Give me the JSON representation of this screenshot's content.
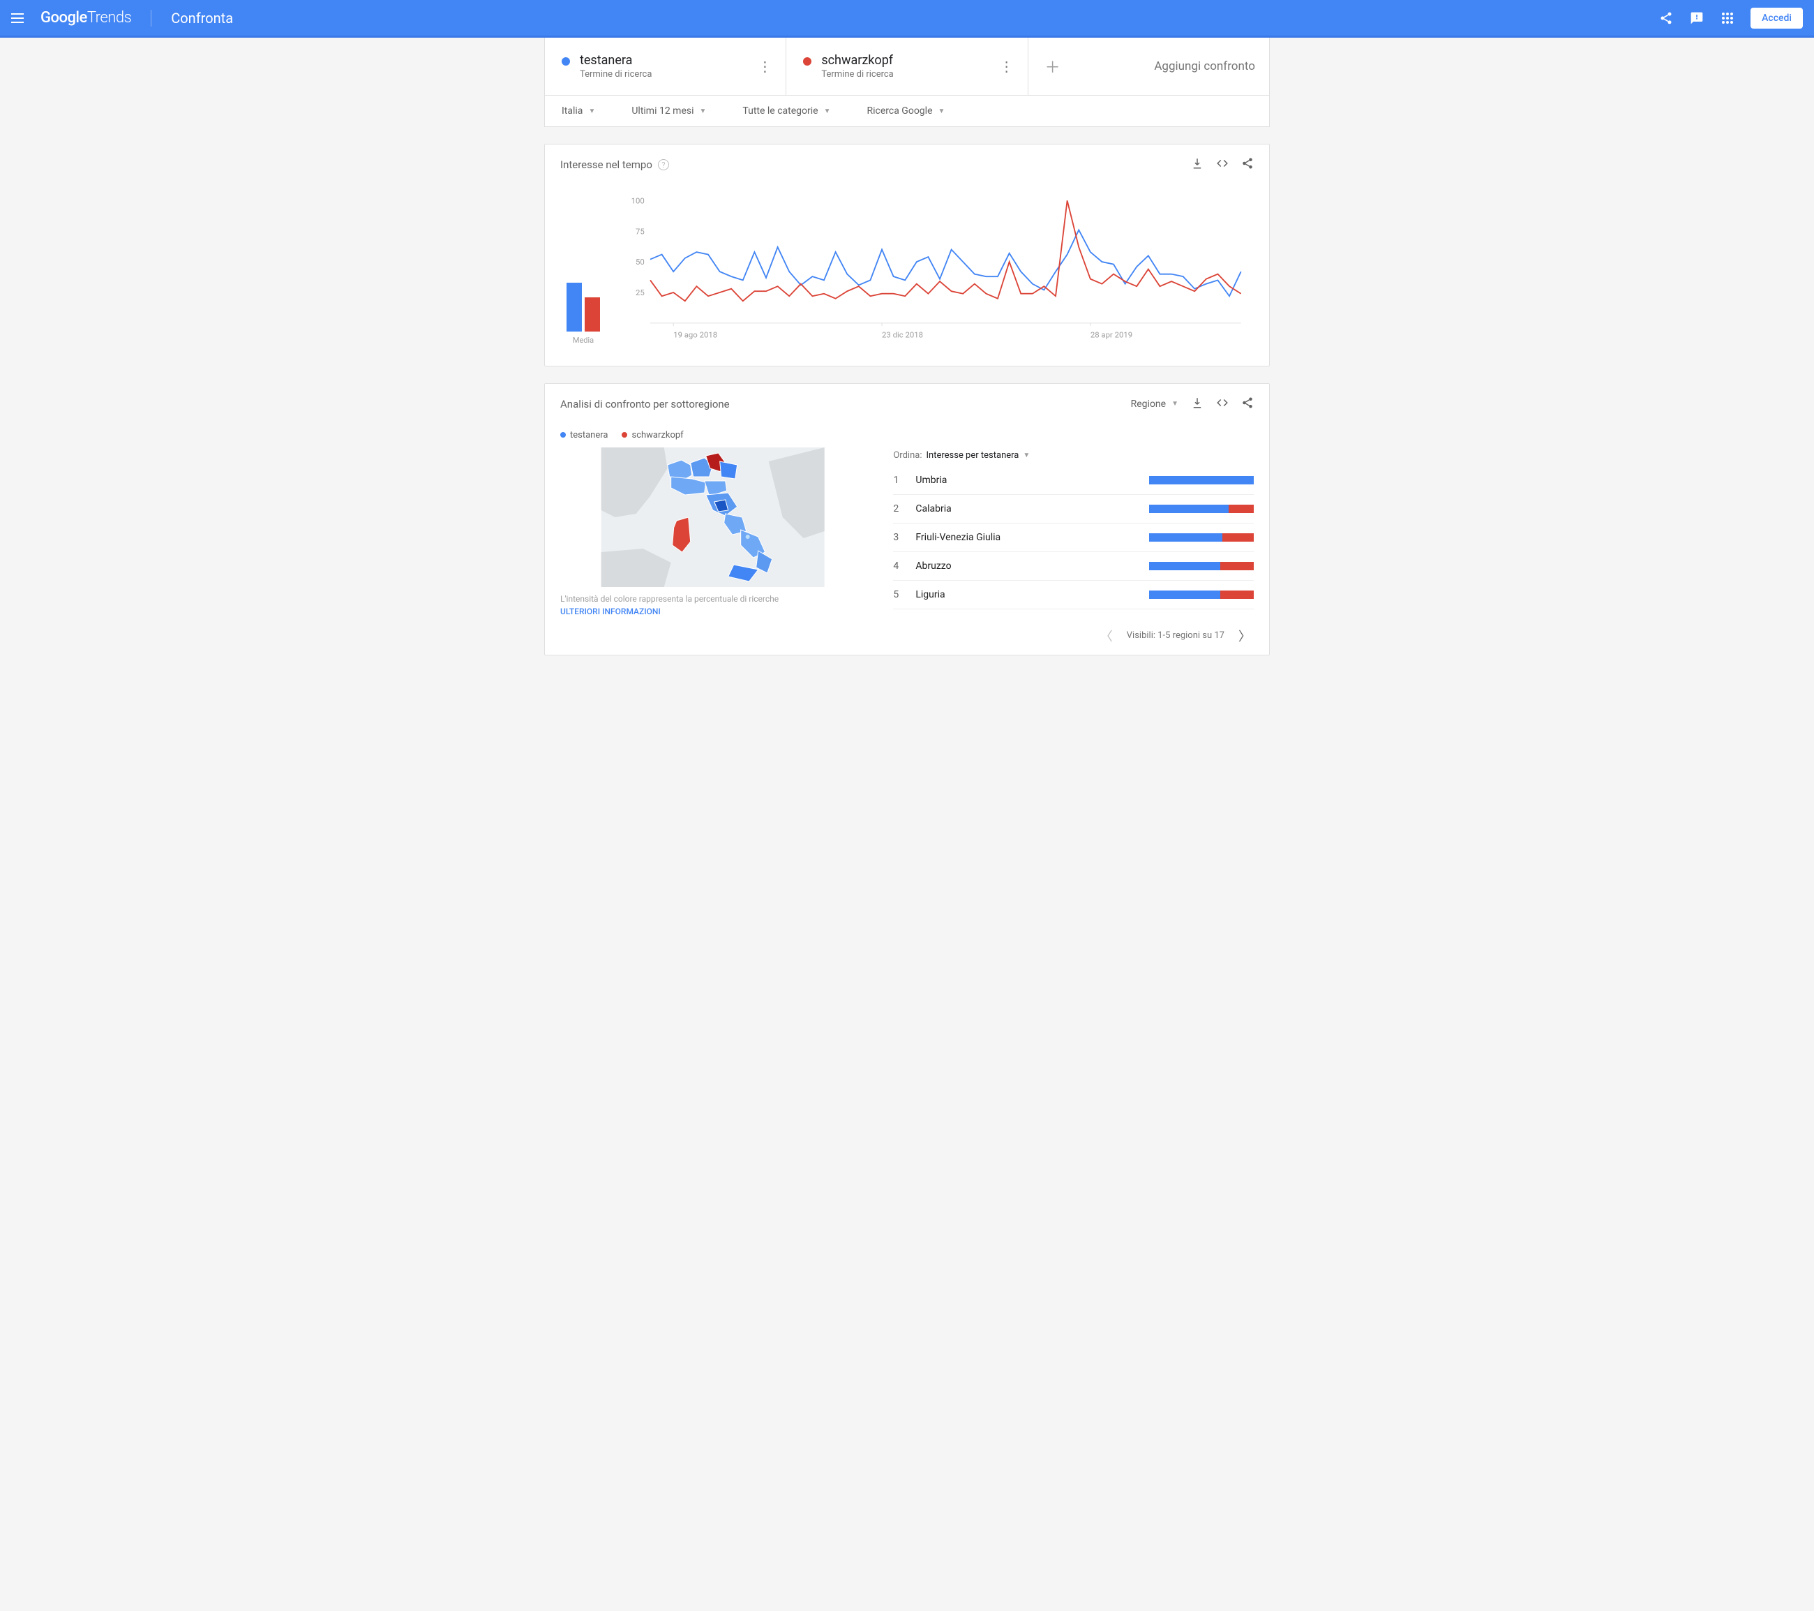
{
  "header": {
    "logo_b": "Google",
    "logo_t": "Trends",
    "title": "Confronta",
    "signin": "Accedi"
  },
  "compare": {
    "terms": [
      {
        "name": "testanera",
        "sub": "Termine di ricerca",
        "color": "#4285f4"
      },
      {
        "name": "schwarzkopf",
        "sub": "Termine di ricerca",
        "color": "#db4437"
      }
    ],
    "add": "Aggiungi confronto"
  },
  "filters": {
    "geo": "Italia",
    "time": "Ultimi 12 mesi",
    "cat": "Tutte le categorie",
    "search": "Ricerca Google"
  },
  "interest": {
    "title": "Interesse nel tempo",
    "avg_label": "Media"
  },
  "region": {
    "title": "Analisi di confronto per sottoregione",
    "selector": "Regione",
    "legend": [
      {
        "name": "testanera",
        "color": "#4285f4"
      },
      {
        "name": "schwarzkopf",
        "color": "#db4437"
      }
    ],
    "sort_label": "Ordina:",
    "sort_value": "Interesse per testanera",
    "map_caption": "L'intensità del colore rappresenta la percentuale di ricerche",
    "map_link": "ULTERIORI INFORMAZIONI",
    "rows": [
      {
        "n": 1,
        "name": "Umbria",
        "a": 100,
        "b": 0
      },
      {
        "n": 2,
        "name": "Calabria",
        "a": 76,
        "b": 24
      },
      {
        "n": 3,
        "name": "Friuli-Venezia Giulia",
        "a": 70,
        "b": 30
      },
      {
        "n": 4,
        "name": "Abruzzo",
        "a": 68,
        "b": 32
      },
      {
        "n": 5,
        "name": "Liguria",
        "a": 68,
        "b": 32
      }
    ],
    "pager": "Visibili: 1-5 regioni su 17"
  },
  "chart_data": {
    "type": "line",
    "title": "Interesse nel tempo",
    "ylabel": "",
    "ylim": [
      0,
      100
    ],
    "yticks": [
      25,
      50,
      75,
      100
    ],
    "x_ticks": [
      "19 ago 2018",
      "23 dic 2018",
      "28 apr 2019"
    ],
    "series": [
      {
        "name": "testanera",
        "color": "#4285f4",
        "avg": 43,
        "values": [
          52,
          56,
          42,
          53,
          58,
          56,
          42,
          38,
          35,
          58,
          37,
          62,
          42,
          31,
          38,
          35,
          58,
          40,
          31,
          35,
          60,
          38,
          35,
          50,
          54,
          36,
          60,
          50,
          40,
          38,
          38,
          57,
          42,
          32,
          27,
          42,
          56,
          76,
          58,
          50,
          48,
          32,
          46,
          55,
          40,
          40,
          38,
          28,
          32,
          35,
          22,
          42
        ]
      },
      {
        "name": "schwarzkopf",
        "color": "#db4437",
        "avg": 30,
        "values": [
          35,
          22,
          25,
          18,
          30,
          22,
          25,
          28,
          18,
          26,
          26,
          30,
          22,
          32,
          22,
          24,
          20,
          26,
          30,
          22,
          24,
          24,
          22,
          32,
          24,
          34,
          26,
          24,
          32,
          24,
          20,
          50,
          24,
          24,
          30,
          22,
          100,
          62,
          36,
          32,
          40,
          34,
          30,
          44,
          30,
          34,
          30,
          26,
          36,
          40,
          30,
          24
        ]
      }
    ]
  }
}
